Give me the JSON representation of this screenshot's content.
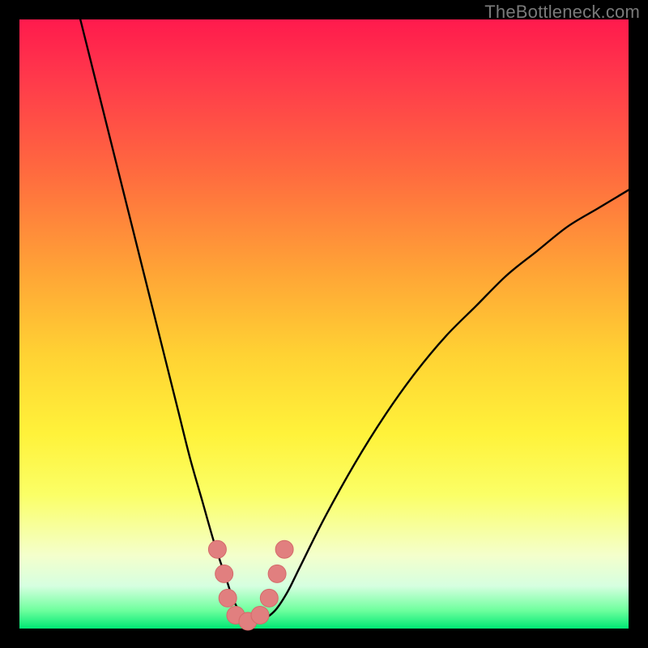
{
  "watermark": "TheBottleneck.com",
  "colors": {
    "frame": "#000000",
    "curve_stroke": "#000000",
    "marker_fill": "#e17f7f",
    "marker_stroke": "#d46a6a"
  },
  "chart_data": {
    "type": "line",
    "title": "",
    "xlabel": "",
    "ylabel": "",
    "xlim": [
      0,
      100
    ],
    "ylim": [
      0,
      100
    ],
    "grid": false,
    "legend": false,
    "series": [
      {
        "name": "bottleneck-curve",
        "x": [
          10,
          12,
          14,
          16,
          18,
          20,
          22,
          24,
          26,
          28,
          30,
          32,
          34,
          35,
          36,
          37,
          38,
          40,
          42,
          44,
          46,
          50,
          55,
          60,
          65,
          70,
          75,
          80,
          85,
          90,
          95,
          100
        ],
        "y": [
          100,
          92,
          84,
          76,
          68,
          60,
          52,
          44,
          36,
          28,
          21,
          14,
          8,
          5,
          3,
          1.5,
          1,
          1.5,
          3,
          6,
          10,
          18,
          27,
          35,
          42,
          48,
          53,
          58,
          62,
          66,
          69,
          72
        ]
      }
    ],
    "markers": [
      {
        "x": 32.5,
        "y": 13
      },
      {
        "x": 33.6,
        "y": 9
      },
      {
        "x": 34.2,
        "y": 5
      },
      {
        "x": 35.5,
        "y": 2.2
      },
      {
        "x": 37.5,
        "y": 1.2
      },
      {
        "x": 39.5,
        "y": 2.2
      },
      {
        "x": 41.0,
        "y": 5
      },
      {
        "x": 42.3,
        "y": 9
      },
      {
        "x": 43.5,
        "y": 13
      }
    ],
    "annotations": []
  }
}
